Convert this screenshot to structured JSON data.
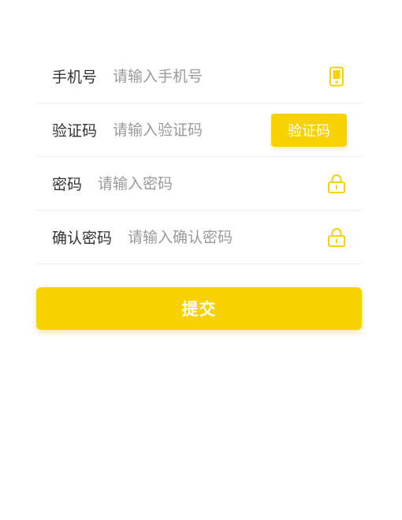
{
  "form": {
    "phone": {
      "label": "手机号",
      "placeholder": "请输入手机号",
      "icon": "phone-icon"
    },
    "code": {
      "label": "验证码",
      "placeholder": "请输入验证码",
      "button_label": "验证码"
    },
    "password": {
      "label": "密码",
      "placeholder": "请输入密码",
      "icon": "lock-icon"
    },
    "confirm_password": {
      "label": "确认密码",
      "placeholder": "请输入确认密码",
      "icon": "lock-icon"
    }
  },
  "submit_label": "提交",
  "colors": {
    "accent": "#f7d200",
    "label": "#333333",
    "placeholder": "#9a9a9a",
    "divider": "#efefef"
  }
}
